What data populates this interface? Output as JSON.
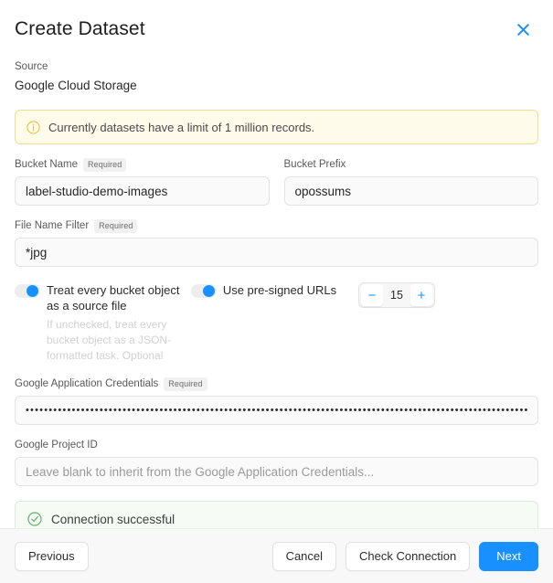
{
  "dialog": {
    "title": "Create Dataset",
    "close_icon": "close-icon"
  },
  "source": {
    "label": "Source",
    "value": "Google Cloud Storage"
  },
  "warning_banner": {
    "icon": "info-circle-icon",
    "text": "Currently datasets have a limit of 1 million records.",
    "bg_color": "#fffbeb",
    "border_color": "#f5dd8f",
    "icon_color": "#e8c34a"
  },
  "fields": {
    "bucket_name": {
      "label": "Bucket Name",
      "badge": "Required",
      "value": "label-studio-demo-images",
      "placeholder": ""
    },
    "bucket_prefix": {
      "label": "Bucket Prefix",
      "badge": "",
      "value": "opossums",
      "placeholder": ""
    },
    "file_name_filter": {
      "label": "File Name Filter",
      "badge": "Required",
      "value": "*jpg",
      "placeholder": ""
    },
    "google_application_credentials": {
      "label": "Google Application Credentials",
      "badge": "Required",
      "value": "••••••••••••••••••••••••••••••••••••••••••••••••••••••••••••••••••••••••••••••••••••••••••••••••••••••••••••••••••••••••••••••••••••••••••••••••••••••••••••••••",
      "placeholder": ""
    },
    "google_project_id": {
      "label": "Google Project ID",
      "badge": "",
      "value": "",
      "placeholder": "Leave blank to inherit from the Google Application Credentials..."
    }
  },
  "toggles": {
    "treat_every_bucket_object": {
      "label": "Treat every bucket object as a source file",
      "state": "on",
      "knob_color": "#1890ff",
      "helper_text": "If unchecked, treat every bucket object as a JSON-formatted task. Optional"
    },
    "use_presigned_urls": {
      "label": "Use pre-signed URLs",
      "state": "on",
      "knob_color": "#1890ff"
    }
  },
  "stepper": {
    "decrement_label": "−",
    "value": "15",
    "increment_label": "+",
    "accent_color": "#1890ff"
  },
  "status_banner": {
    "icon": "check-circle-icon",
    "text": "Connection successful",
    "bg_color": "#f6fbf6",
    "border_color": "#d9ecd9",
    "icon_color": "#67b26b"
  },
  "footer": {
    "previous_label": "Previous",
    "cancel_label": "Cancel",
    "check_connection_label": "Check Connection",
    "next_label": "Next",
    "primary_color": "#1890ff"
  }
}
